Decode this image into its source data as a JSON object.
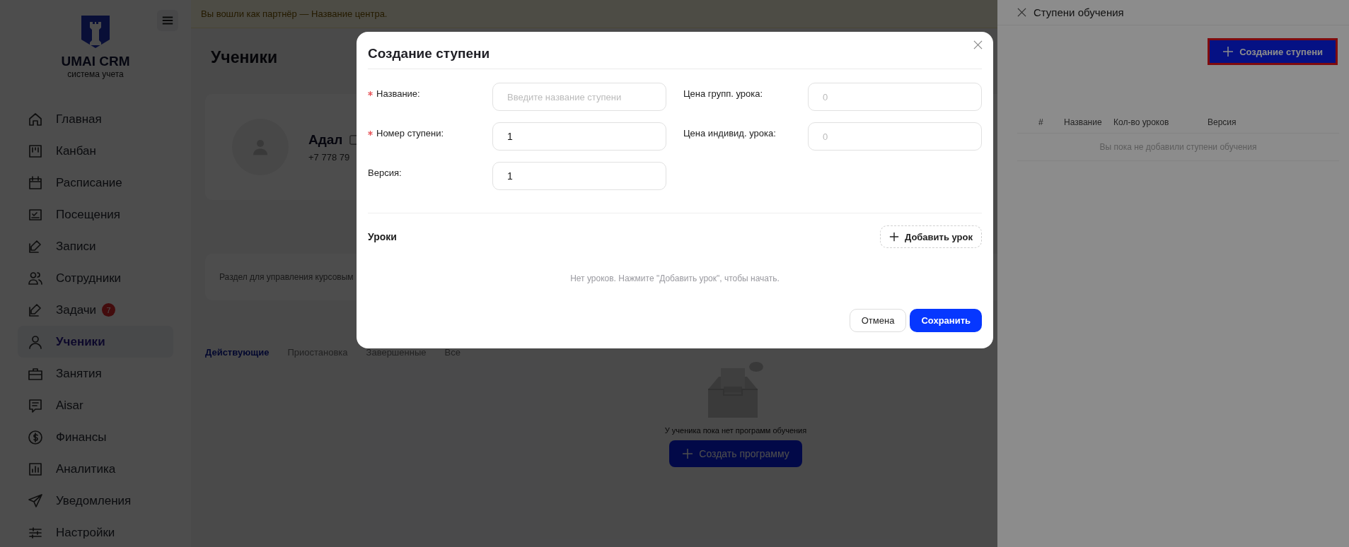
{
  "banner": "Вы вошли как партнёр — Название центра.",
  "sidebar": {
    "logo": {
      "title": "UMAI CRM",
      "subtitle": "система учета"
    },
    "items": [
      {
        "label": "Главная",
        "selected": false
      },
      {
        "label": "Канбан",
        "selected": false
      },
      {
        "label": "Расписание",
        "selected": false
      },
      {
        "label": "Посещения",
        "selected": false
      },
      {
        "label": "Записи",
        "selected": false
      },
      {
        "label": "Сотрудники",
        "selected": false
      },
      {
        "label": "Задачи",
        "selected": false,
        "badge": "7"
      },
      {
        "label": "Ученики",
        "selected": true
      },
      {
        "label": "Занятия",
        "selected": false
      },
      {
        "label": "Aisar",
        "selected": false
      },
      {
        "label": "Финансы",
        "selected": false
      },
      {
        "label": "Аналитика",
        "selected": false
      },
      {
        "label": "Уведомления",
        "selected": false
      },
      {
        "label": "Настройки",
        "selected": false
      }
    ]
  },
  "page": {
    "title": "Ученики",
    "student": {
      "name": "Адал",
      "phone": "+7 778 79"
    },
    "description": "Раздел для управления курсовым",
    "tabs": [
      {
        "label": "Действующие",
        "selected": true
      },
      {
        "label": "Приостановка",
        "selected": false
      },
      {
        "label": "Завершенные",
        "selected": false
      },
      {
        "label": "Все",
        "selected": false
      }
    ],
    "empty_state": {
      "text": "У ученика пока нет программ обучения",
      "button": "Создать программу"
    }
  },
  "drawer": {
    "title": "Ступени обучения",
    "create_button": "Создание ступени",
    "table": {
      "columns": [
        "#",
        "Название",
        "Кол-во уроков",
        "Версия"
      ],
      "empty_text": "Вы пока не добавили ступени обучения"
    }
  },
  "modal": {
    "title": "Создание ступени",
    "left_fields": [
      {
        "label": "Название:",
        "required": true,
        "placeholder": "Введите название ступени"
      },
      {
        "label": "Номер ступени:",
        "required": true,
        "value": "1"
      },
      {
        "label": "Версия:",
        "required": false,
        "value": "1"
      }
    ],
    "right_fields": [
      {
        "label": "Цена групп. урока:",
        "required": false,
        "placeholder": "0"
      },
      {
        "label": "Цена индивид. урока:",
        "required": false,
        "placeholder": "0"
      }
    ],
    "lessons": {
      "title": "Уроки",
      "add_button": "Добавить урок",
      "empty_text": "Нет уроков. Нажмите \"Добавить урок\", чтобы начать."
    },
    "buttons": {
      "cancel": "Отмена",
      "save": "Сохранить"
    }
  }
}
